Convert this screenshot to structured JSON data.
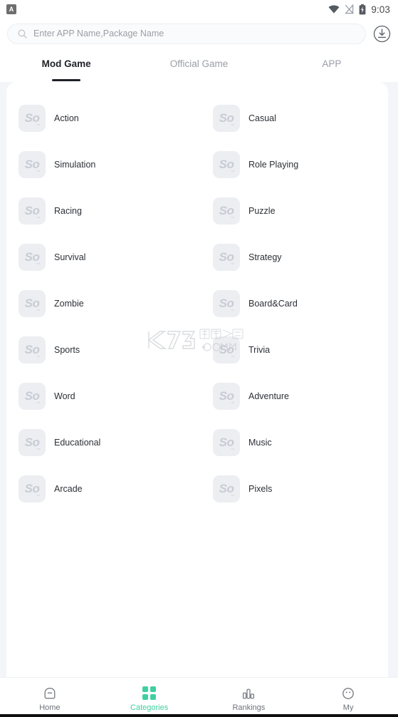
{
  "statusbar": {
    "app_badge": "A",
    "time": "9:03",
    "icons": [
      "wifi-icon",
      "signal-off-icon",
      "battery-charging-icon"
    ]
  },
  "search": {
    "placeholder": "Enter APP Name,Package Name",
    "value": "",
    "icon": "search-icon",
    "download_icon": "download-circle-icon"
  },
  "tabs": [
    {
      "label": "Mod Game",
      "active": true
    },
    {
      "label": "Official Game",
      "active": false
    },
    {
      "label": "APP",
      "active": false
    }
  ],
  "categories": [
    {
      "label": "Action",
      "icon": "placeholder-image-icon"
    },
    {
      "label": "Casual",
      "icon": "placeholder-image-icon"
    },
    {
      "label": "Simulation",
      "icon": "placeholder-image-icon"
    },
    {
      "label": "Role Playing",
      "icon": "placeholder-image-icon"
    },
    {
      "label": "Racing",
      "icon": "placeholder-image-icon"
    },
    {
      "label": "Puzzle",
      "icon": "placeholder-image-icon"
    },
    {
      "label": "Survival",
      "icon": "placeholder-image-icon"
    },
    {
      "label": "Strategy",
      "icon": "placeholder-image-icon"
    },
    {
      "label": "Zombie",
      "icon": "placeholder-image-icon"
    },
    {
      "label": "Board&Card",
      "icon": "placeholder-image-icon"
    },
    {
      "label": "Sports",
      "icon": "placeholder-image-icon"
    },
    {
      "label": "Trivia",
      "icon": "placeholder-image-icon"
    },
    {
      "label": "Word",
      "icon": "placeholder-image-icon"
    },
    {
      "label": "Adventure",
      "icon": "placeholder-image-icon"
    },
    {
      "label": "Educational",
      "icon": "placeholder-image-icon"
    },
    {
      "label": "Music",
      "icon": "placeholder-image-icon"
    },
    {
      "label": "Arcade",
      "icon": "placeholder-image-icon"
    },
    {
      "label": "Pixels",
      "icon": "placeholder-image-icon"
    }
  ],
  "icon_placeholder": {
    "glyph": "So",
    "sub": "no"
  },
  "watermark": {
    "main": "K73",
    "cn": "游戏之家",
    "domain": ".com"
  },
  "bottom_nav": [
    {
      "label": "Home",
      "icon": "home-icon",
      "active": false
    },
    {
      "label": "Categories",
      "icon": "grid-icon",
      "active": true
    },
    {
      "label": "Rankings",
      "icon": "bar-chart-icon",
      "active": false
    },
    {
      "label": "My",
      "icon": "face-icon",
      "active": false
    }
  ],
  "colors": {
    "accent": "#3ecfa0",
    "page_bg": "#f4f5f9",
    "card_bg": "#ffffff",
    "text_primary": "#2c3036",
    "text_muted": "#9a9ea6"
  }
}
